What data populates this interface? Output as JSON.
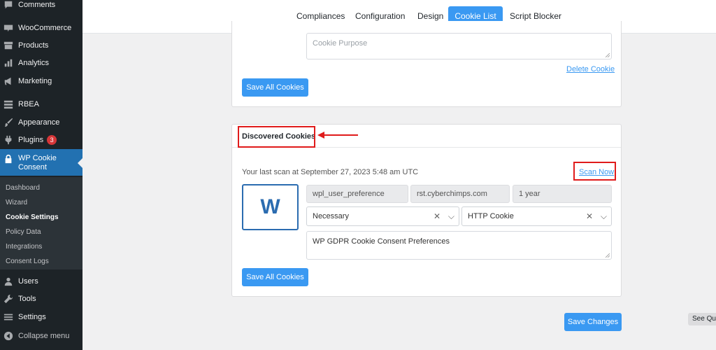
{
  "sidebar": {
    "items": [
      {
        "label": "Comments",
        "icon": "comment-icon"
      },
      {
        "label": "WooCommerce",
        "icon": "woocommerce-icon"
      },
      {
        "label": "Products",
        "icon": "archive-icon"
      },
      {
        "label": "Analytics",
        "icon": "bar-chart-icon"
      },
      {
        "label": "Marketing",
        "icon": "megaphone-icon"
      },
      {
        "label": "RBEA",
        "icon": "grid-icon"
      },
      {
        "label": "Appearance",
        "icon": "brush-icon"
      },
      {
        "label": "Plugins",
        "icon": "plugin-icon",
        "badge": "3"
      },
      {
        "label": "WP Cookie Consent",
        "icon": "lock-icon"
      },
      {
        "label": "Users",
        "icon": "user-icon"
      },
      {
        "label": "Tools",
        "icon": "wrench-icon"
      },
      {
        "label": "Settings",
        "icon": "settings-icon"
      },
      {
        "label": "Collapse menu",
        "icon": "collapse-icon"
      }
    ],
    "submenu": [
      "Dashboard",
      "Wizard",
      "Cookie Settings",
      "Policy Data",
      "Integrations",
      "Consent Logs"
    ]
  },
  "tabs": [
    "Compliances",
    "Configuration",
    "Design",
    "Cookie List",
    "Script Blocker"
  ],
  "top_card": {
    "purpose_placeholder": "Cookie Purpose",
    "delete_link": "Delete Cookie",
    "save_label": "Save All Cookies"
  },
  "discovered": {
    "title": "Discovered Cookies",
    "last_scan": "Your last scan at September 27, 2023 5:48 am UTC",
    "scan_now": "Scan Now",
    "cookie": {
      "logo_letter": "W",
      "name": "wpl_user_preference",
      "domain": "rst.cyberchimps.com",
      "duration": "1 year",
      "category": "Necessary",
      "type": "HTTP Cookie",
      "description": "WP GDPR Cookie Consent Preferences"
    },
    "save_label": "Save All Cookies"
  },
  "save_changes": "Save Changes",
  "see_quick": "See Qui",
  "colors": {
    "accent": "#3a99f2",
    "annotation": "#e01b1b",
    "sidebar": "#1d2327",
    "active_menu": "#2271b1"
  }
}
